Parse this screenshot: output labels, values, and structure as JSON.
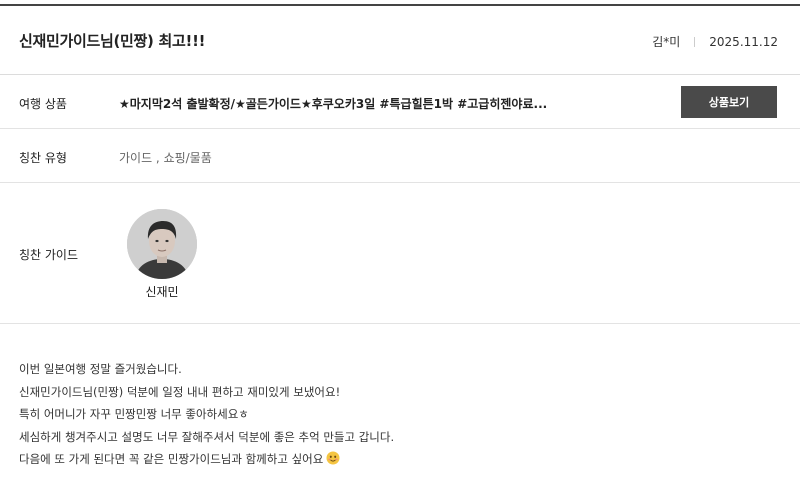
{
  "review": {
    "title": "신재민가이드님(민짱) 최고!!!",
    "author": "김*미",
    "date": "2025.11.12"
  },
  "rows": {
    "product": {
      "label": "여행 상품",
      "value": "★마지막2석 출발확정/★골든가이드★후쿠오카3일 #특급힐튼1박 #고급히젠야료...",
      "button_label": "상품보기"
    },
    "praise_type": {
      "label": "칭찬 유형",
      "value": "가이드 , 쇼핑/물품"
    },
    "guide": {
      "label": "칭찬 가이드",
      "name": "신재민"
    }
  },
  "body": {
    "lines": [
      "이번 일본여행 정말 즐거웠습니다.",
      "신재민가이드님(민짱) 덕분에 일정 내내 편하고 재미있게 보냈어요!",
      "특히 어머니가 자꾸 민짱민짱 너무 좋아하세요ㅎ",
      "세심하게 챙겨주시고 설명도 너무 잘해주셔서 덕분에 좋은 추억 만들고 갑니다.",
      "다음에 또 가게 된다면 꼭 같은 민짱가이드님과 함께하고 싶어요"
    ],
    "emoji_icon": "smiling-face-emoji"
  },
  "colors": {
    "button_bg": "#4a4a4a",
    "button_text": "#ffffff",
    "divider": "#e3e3e3",
    "top_rule": "#444444"
  }
}
